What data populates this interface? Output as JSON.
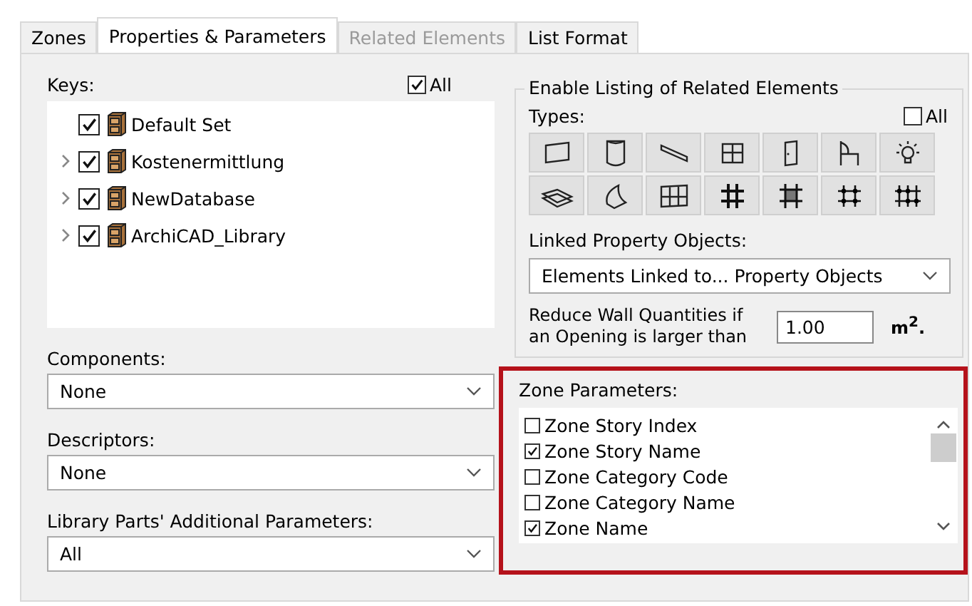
{
  "tabs": [
    {
      "label": "Zones",
      "selected": false,
      "disabled": false
    },
    {
      "label": "Properties & Parameters",
      "selected": true,
      "disabled": false
    },
    {
      "label": "Related Elements",
      "selected": false,
      "disabled": true
    },
    {
      "label": "List Format",
      "selected": false,
      "disabled": false
    }
  ],
  "keys": {
    "label": "Keys:",
    "all": {
      "label": "All",
      "checked": true
    },
    "items": [
      {
        "label": "Default Set",
        "checked": true,
        "has_children": false
      },
      {
        "label": "Kostenermittlung",
        "checked": true,
        "has_children": true
      },
      {
        "label": "NewDatabase",
        "checked": true,
        "has_children": true
      },
      {
        "label": "ArchiCAD_Library",
        "checked": true,
        "has_children": true
      }
    ]
  },
  "components": {
    "label": "Components:",
    "value": "None"
  },
  "descriptors": {
    "label": "Descriptors:",
    "value": "None"
  },
  "library_parameters": {
    "label": "Library Parts' Additional Parameters:",
    "value": "All"
  },
  "related_elements": {
    "title": "Enable Listing of Related Elements",
    "types_label": "Types:",
    "all": {
      "label": "All",
      "checked": false
    },
    "linked_label": "Linked Property Objects:",
    "linked_value": "Elements Linked to... Property Objects",
    "reduce_label": "Reduce Wall Quantities if an Opening is larger than",
    "reduce_value": "1.00",
    "reduce_unit": "m$^{2}$."
  },
  "zone_parameters": {
    "label": "Zone Parameters:",
    "highlighted": true,
    "items": [
      {
        "label": "Zone Story Index",
        "checked": false
      },
      {
        "label": "Zone Story Name",
        "checked": true
      },
      {
        "label": "Zone Category Code",
        "checked": false
      },
      {
        "label": "Zone Category Name",
        "checked": false
      },
      {
        "label": "Zone Name",
        "checked": true
      }
    ]
  }
}
